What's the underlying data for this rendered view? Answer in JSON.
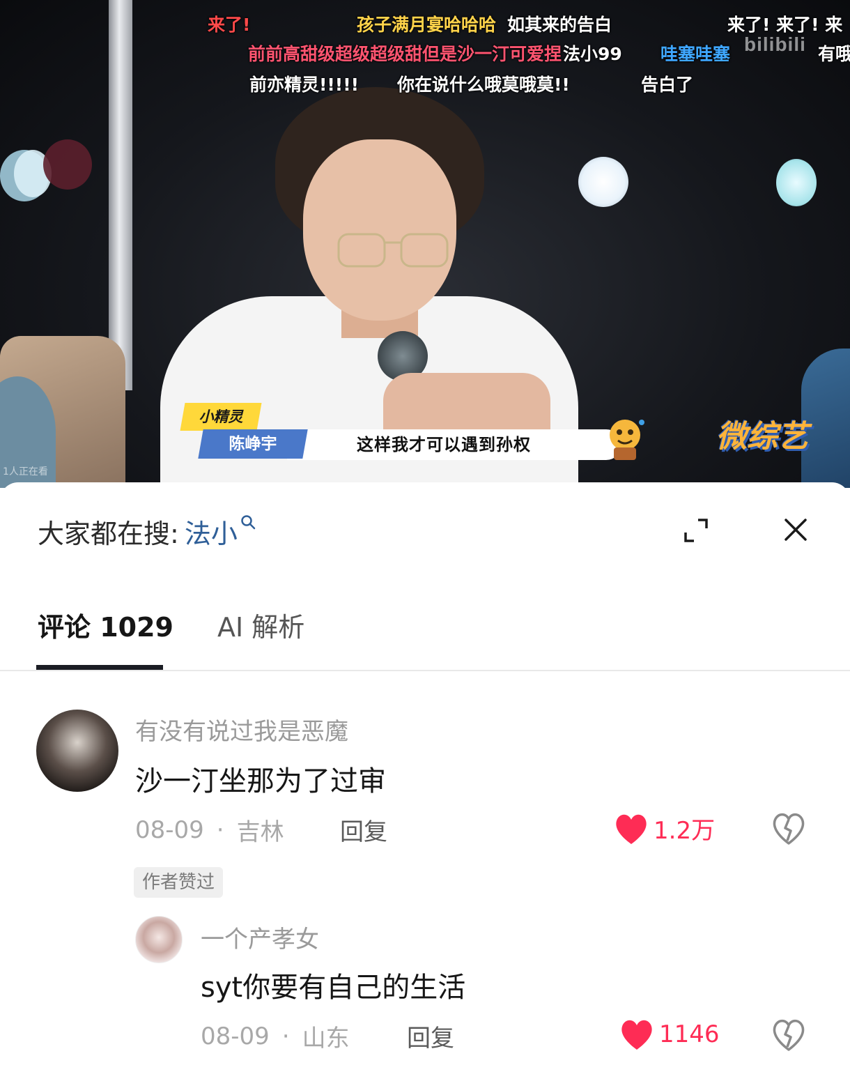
{
  "video": {
    "danmaku": [
      {
        "text": "来了!",
        "color": "#ff4a4a"
      },
      {
        "text": "孩子满月宴哈哈哈",
        "color": "#ffd34a"
      },
      {
        "text": "如其来的告白",
        "color": "#ffffff"
      },
      {
        "text": "来了! 来了! 来",
        "color": "#ffffff"
      },
      {
        "text": "前前高甜级超级超级甜但是沙一汀可爱捏",
        "color": "#ff5470"
      },
      {
        "text": "法小99",
        "color": "#ffffff"
      },
      {
        "text": "哇塞哇塞",
        "color": "#3fa7ff"
      },
      {
        "text": "有哦",
        "color": "#ffffff"
      },
      {
        "text": "前亦精灵!!!!!",
        "color": "#ffffff"
      },
      {
        "text": "你在说什么哦莫哦莫!!",
        "color": "#ffffff"
      },
      {
        "text": "告白了",
        "color": "#ffffff"
      }
    ],
    "watermark": "bilibili",
    "name_tag_role": "小精灵",
    "name_tag_name": "陈峥宇",
    "subtitle": "这样我才可以遇到孙权",
    "show_logo": "微综艺",
    "viewer_count": "1人正在看"
  },
  "search": {
    "prefix": "大家都在搜:",
    "term": "法小"
  },
  "icons": {
    "search_icon": "magnifier-icon",
    "expand_icon": "expand-icon",
    "close_icon": "close-icon",
    "heart_icon": "heart-icon",
    "dislike_icon": "broken-heart-icon"
  },
  "tabs": [
    {
      "label": "评论 1029",
      "active": true
    },
    {
      "label": "AI 解析",
      "active": false
    }
  ],
  "comments": [
    {
      "username": "有没有说过我是恶魔",
      "text": "沙一汀坐那为了过审",
      "date": "08-09",
      "location": "吉林",
      "reply_label": "回复",
      "likes": "1.2万",
      "badge": "作者赞过",
      "replies": [
        {
          "username": "一个产孝女",
          "text": "syt你要有自己的生活",
          "date": "08-09",
          "location": "山东",
          "reply_label": "回复",
          "likes": "1146"
        }
      ]
    }
  ],
  "colors": {
    "accent_like": "#fe2c55",
    "search_term": "#2f5f98",
    "tab_underline": "#1b1d24"
  },
  "separator": "·"
}
